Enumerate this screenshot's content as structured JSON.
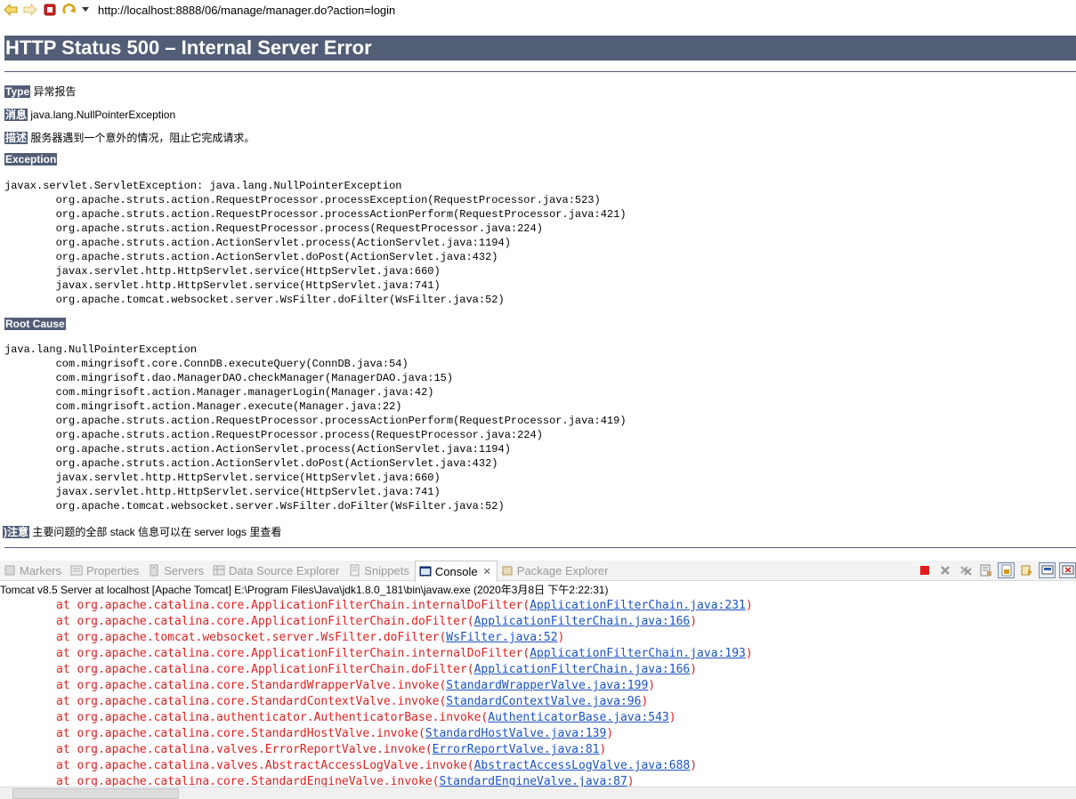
{
  "browser": {
    "url": "http://localhost:8888/06/manage/manager.do?action=login"
  },
  "error_page": {
    "title": "HTTP Status 500 – Internal Server Error",
    "type_label": "Type",
    "type_value": "异常报告",
    "message_label": "消息",
    "message_value": "java.lang.NullPointerException",
    "description_label": "描述",
    "description_value": "服务器遇到一个意外的情况，阻止它完成请求。",
    "exception_heading": "Exception",
    "exception_trace": "javax.servlet.ServletException: java.lang.NullPointerException\n\torg.apache.struts.action.RequestProcessor.processException(RequestProcessor.java:523)\n\torg.apache.struts.action.RequestProcessor.processActionPerform(RequestProcessor.java:421)\n\torg.apache.struts.action.RequestProcessor.process(RequestProcessor.java:224)\n\torg.apache.struts.action.ActionServlet.process(ActionServlet.java:1194)\n\torg.apache.struts.action.ActionServlet.doPost(ActionServlet.java:432)\n\tjavax.servlet.http.HttpServlet.service(HttpServlet.java:660)\n\tjavax.servlet.http.HttpServlet.service(HttpServlet.java:741)\n\torg.apache.tomcat.websocket.server.WsFilter.doFilter(WsFilter.java:52)",
    "root_cause_heading": "Root Cause",
    "root_cause_trace": "java.lang.NullPointerException\n\tcom.mingrisoft.core.ConnDB.executeQuery(ConnDB.java:54)\n\tcom.mingrisoft.dao.ManagerDAO.checkManager(ManagerDAO.java:15)\n\tcom.mingrisoft.action.Manager.managerLogin(Manager.java:42)\n\tcom.mingrisoft.action.Manager.execute(Manager.java:22)\n\torg.apache.struts.action.RequestProcessor.processActionPerform(RequestProcessor.java:419)\n\torg.apache.struts.action.RequestProcessor.process(RequestProcessor.java:224)\n\torg.apache.struts.action.ActionServlet.process(ActionServlet.java:1194)\n\torg.apache.struts.action.ActionServlet.doPost(ActionServlet.java:432)\n\tjavax.servlet.http.HttpServlet.service(HttpServlet.java:660)\n\tjavax.servlet.http.HttpServlet.service(HttpServlet.java:741)\n\torg.apache.tomcat.websocket.server.WsFilter.doFilter(WsFilter.java:52)",
    "note_label": ")注意",
    "note_value": "主要问题的全部 stack 信息可以在 server logs 里查看"
  },
  "views": {
    "tabs": [
      {
        "label": "Markers",
        "icon": "markers-icon"
      },
      {
        "label": "Properties",
        "icon": "properties-icon"
      },
      {
        "label": "Servers",
        "icon": "servers-icon"
      },
      {
        "label": "Data Source Explorer",
        "icon": "data-source-icon"
      },
      {
        "label": "Snippets",
        "icon": "snippets-icon"
      },
      {
        "label": "Console",
        "icon": "console-icon",
        "active": true
      },
      {
        "label": "Package Explorer",
        "icon": "package-explorer-icon"
      }
    ],
    "console_title": "Tomcat v8.5 Server at localhost [Apache Tomcat] E:\\Program Files\\Java\\jdk1.8.0_181\\bin\\javaw.exe (2020年3月8日 下午2:22:31)",
    "console_lines": [
      {
        "pre": "at org.apache.catalina.core.ApplicationFilterChain.internalDoFilter(",
        "link": "ApplicationFilterChain.java:231",
        "post": ")"
      },
      {
        "pre": "at org.apache.catalina.core.ApplicationFilterChain.doFilter(",
        "link": "ApplicationFilterChain.java:166",
        "post": ")"
      },
      {
        "pre": "at org.apache.tomcat.websocket.server.WsFilter.doFilter(",
        "link": "WsFilter.java:52",
        "post": ")"
      },
      {
        "pre": "at org.apache.catalina.core.ApplicationFilterChain.internalDoFilter(",
        "link": "ApplicationFilterChain.java:193",
        "post": ")"
      },
      {
        "pre": "at org.apache.catalina.core.ApplicationFilterChain.doFilter(",
        "link": "ApplicationFilterChain.java:166",
        "post": ")"
      },
      {
        "pre": "at org.apache.catalina.core.StandardWrapperValve.invoke(",
        "link": "StandardWrapperValve.java:199",
        "post": ")"
      },
      {
        "pre": "at org.apache.catalina.core.StandardContextValve.invoke(",
        "link": "StandardContextValve.java:96",
        "post": ")"
      },
      {
        "pre": "at org.apache.catalina.authenticator.AuthenticatorBase.invoke(",
        "link": "AuthenticatorBase.java:543",
        "post": ")"
      },
      {
        "pre": "at org.apache.catalina.core.StandardHostValve.invoke(",
        "link": "StandardHostValve.java:139",
        "post": ")"
      },
      {
        "pre": "at org.apache.catalina.valves.ErrorReportValve.invoke(",
        "link": "ErrorReportValve.java:81",
        "post": ")"
      },
      {
        "pre": "at org.apache.catalina.valves.AbstractAccessLogValve.invoke(",
        "link": "AbstractAccessLogValve.java:688",
        "post": ")"
      },
      {
        "pre": "at org.apache.catalina.core.StandardEngineValve.invoke(",
        "link": "StandardEngineValve.java:87",
        "post": ")"
      }
    ]
  },
  "colors": {
    "heading_bg": "#525d76",
    "console_error": "#e02020",
    "console_link": "#1b53c5"
  }
}
